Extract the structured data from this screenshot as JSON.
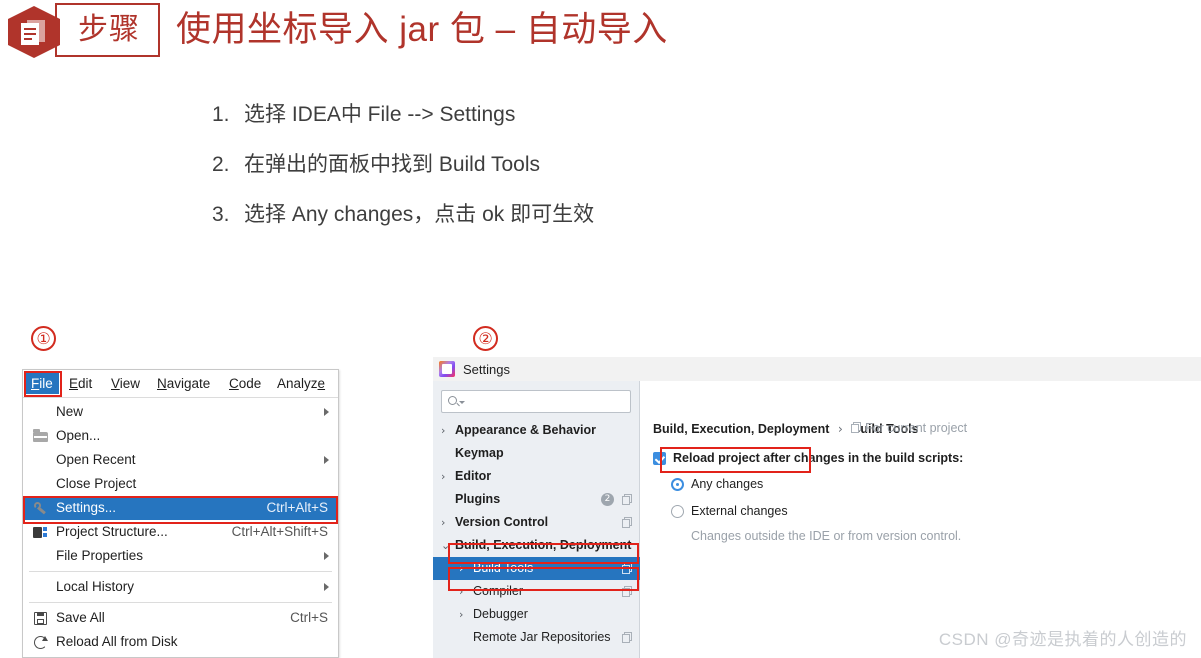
{
  "header": {
    "badge_icon": "document-hex-icon",
    "badge_label": "步骤",
    "title": "使用坐标导入 jar 包 – 自动导入",
    "accent_color": "#B0342B"
  },
  "steps": [
    {
      "num": "1.",
      "text": "选择 IDEA中 File --> Settings"
    },
    {
      "num": "2.",
      "text": "在弹出的面板中找到 Build Tools"
    },
    {
      "num": "3.",
      "text": "选择 Any changes，点击 ok 即可生效"
    }
  ],
  "markers": {
    "one": "①",
    "two": "②",
    "color": "#D22B1F"
  },
  "annotation": {
    "box_color": "#E2231A"
  },
  "menu_panel": {
    "menubar": [
      {
        "pre": "F",
        "mnemonic": "",
        "post": "ile",
        "label": "File",
        "active": true
      },
      {
        "pre": "",
        "mnemonic": "E",
        "post": "dit",
        "label": "Edit",
        "active": false
      },
      {
        "pre": "",
        "mnemonic": "V",
        "post": "iew",
        "label": "View",
        "active": false
      },
      {
        "pre": "",
        "mnemonic": "N",
        "post": "avigate",
        "label": "Navigate",
        "active": false
      },
      {
        "pre": "",
        "mnemonic": "C",
        "post": "ode",
        "label": "Code",
        "active": false
      },
      {
        "pre": "Analyz",
        "mnemonic": "e",
        "post": "",
        "label": "Analyze",
        "active": false
      }
    ],
    "items": [
      {
        "label": "New",
        "accel": "",
        "icon": "none",
        "arrow": true,
        "selected": false
      },
      {
        "label": "Open...",
        "accel": "",
        "icon": "folder-icon",
        "arrow": false,
        "selected": false
      },
      {
        "label": "Open Recent",
        "accel": "",
        "icon": "none",
        "arrow": true,
        "selected": false
      },
      {
        "label": "Close Project",
        "accel": "",
        "icon": "none",
        "arrow": false,
        "selected": false
      },
      {
        "label": "Settings...",
        "accel": "Ctrl+Alt+S",
        "icon": "wrench-icon",
        "arrow": false,
        "selected": true
      },
      {
        "label": "Project Structure...",
        "accel": "Ctrl+Alt+Shift+S",
        "icon": "project-icon",
        "arrow": false,
        "selected": false
      },
      {
        "label": "File Properties",
        "accel": "",
        "icon": "none",
        "arrow": true,
        "selected": false
      },
      {
        "label": "Local History",
        "accel": "",
        "icon": "none",
        "arrow": true,
        "selected": false
      },
      {
        "label": "Save All",
        "accel": "Ctrl+S",
        "icon": "save-icon",
        "arrow": false,
        "selected": false
      },
      {
        "label": "Reload All from Disk",
        "accel": "",
        "icon": "reload-icon",
        "arrow": false,
        "selected": false
      }
    ]
  },
  "settings": {
    "window_title": "Settings",
    "app_icon": "intellij-idea-icon",
    "app_icon_text": "IJ",
    "search": {
      "value": "",
      "placeholder": "",
      "icon": "search-icon"
    },
    "tree": [
      {
        "label": "Appearance & Behavior",
        "level": 1,
        "chevron": "›",
        "badge": "",
        "scope_icon": false,
        "selected": false
      },
      {
        "label": "Keymap",
        "level": 1,
        "chevron": "",
        "badge": "",
        "scope_icon": false,
        "selected": false
      },
      {
        "label": "Editor",
        "level": 1,
        "chevron": "›",
        "badge": "",
        "scope_icon": false,
        "selected": false
      },
      {
        "label": "Plugins",
        "level": 1,
        "chevron": "",
        "badge": "2",
        "scope_icon": true,
        "selected": false
      },
      {
        "label": "Version Control",
        "level": 1,
        "chevron": "›",
        "badge": "",
        "scope_icon": true,
        "selected": false
      },
      {
        "label": "Build, Execution, Deployment",
        "level": 1,
        "chevron": "⌄",
        "badge": "",
        "scope_icon": false,
        "selected": false
      },
      {
        "label": "Build Tools",
        "level": 2,
        "chevron": "›",
        "badge": "",
        "scope_icon": true,
        "selected": true
      },
      {
        "label": "Compiler",
        "level": 2,
        "chevron": "›",
        "badge": "",
        "scope_icon": true,
        "selected": false
      },
      {
        "label": "Debugger",
        "level": 2,
        "chevron": "›",
        "badge": "",
        "scope_icon": false,
        "selected": false
      },
      {
        "label": "Remote Jar Repositories",
        "level": 2,
        "chevron": "",
        "badge": "",
        "scope_icon": true,
        "selected": false
      }
    ],
    "breadcrumb": {
      "root": "Build, Execution, Deployment",
      "separator": "›",
      "leaf": "Build Tools"
    },
    "scope_label": "For current project",
    "checkbox": {
      "label": "Reload project after changes in the build scripts:",
      "checked": true
    },
    "radios": [
      {
        "label": "Any changes",
        "selected": true
      },
      {
        "label": "External changes",
        "selected": false
      }
    ],
    "radio_hint": "Changes outside the IDE or from version control.",
    "accent_blue": "#2675BF"
  },
  "watermark": "CSDN @奇迹是执着的人创造的"
}
